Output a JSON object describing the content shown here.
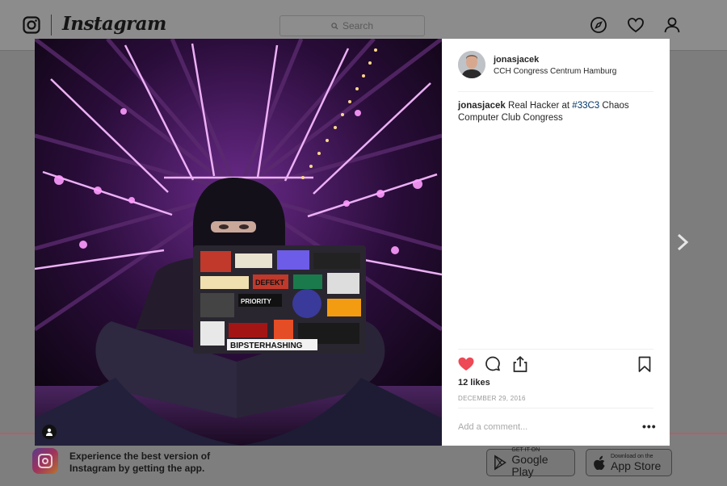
{
  "app": {
    "brand": "Instagram"
  },
  "header": {
    "search_placeholder": "Search",
    "icons": [
      "instagram-logo-icon",
      "compass-icon",
      "heart-icon",
      "profile-icon"
    ]
  },
  "post": {
    "username": "jonasjacek",
    "location": "CCH Congress Centrum Hamburg",
    "caption": {
      "author": "jonasjacek",
      "text_before": "Real Hacker at ",
      "hashtag": "#33C3",
      "text_after": " Chaos Computer Club Congress"
    },
    "likes": "12 likes",
    "date": "DECEMBER 29, 2016",
    "liked": true,
    "comment_placeholder": "Add a comment...",
    "more_label": "•••",
    "photo_stickers": [
      "DEFEKT",
      "PRIORITY",
      "BIPSTERHASHING"
    ],
    "colors": {
      "like": "#ed4956",
      "hashtag": "#003569",
      "light": "#e070ff"
    }
  },
  "banner": {
    "text": "Experience the best version of Instagram by getting the app.",
    "google_play": {
      "small": "GET IT ON",
      "big": "Google Play"
    },
    "app_store": {
      "small": "Download on the",
      "big": "App Store"
    }
  }
}
